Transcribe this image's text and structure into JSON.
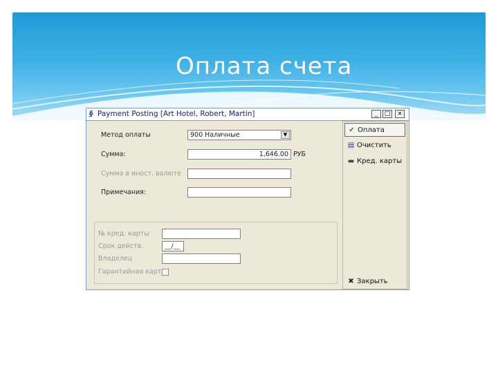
{
  "slide": {
    "title": "Оплата счета"
  },
  "window": {
    "title": "Payment Posting  [Art Hotel, Robert, Martin]",
    "icon": "payment-icon",
    "minimize": "_",
    "maximize": "□",
    "close": "×"
  },
  "form": {
    "method_label": "Метод оплаты",
    "method_value": "900   Наличные",
    "amount_label": "Сумма:",
    "amount_value": "1,646.00",
    "currency": "РУБ",
    "foreign_amount_label": "Сумма в иност. валюте",
    "foreign_amount_value": "",
    "notes_label": "Примечания:",
    "notes_value": "",
    "card_number_label": "№ кред. карты",
    "card_number_value": "",
    "expiry_label": "Срок действ.",
    "expiry_value": "__/__",
    "owner_label": "Владелец",
    "owner_value": "",
    "guarantee_label": "Гарантийная карт"
  },
  "actions": {
    "pay": {
      "label": "Оплата",
      "icon": "checkmark-icon"
    },
    "clear": {
      "label": "Очистить",
      "icon": "clear-icon"
    },
    "cards": {
      "label": "Кред. карты",
      "icon": "credit-card-icon"
    },
    "close": {
      "label": "Закрыть",
      "icon": "close-icon"
    }
  },
  "colors": {
    "header_blue": "#1e9ad6",
    "window_bg": "#ece9d8",
    "title_text": "#1a237e"
  }
}
